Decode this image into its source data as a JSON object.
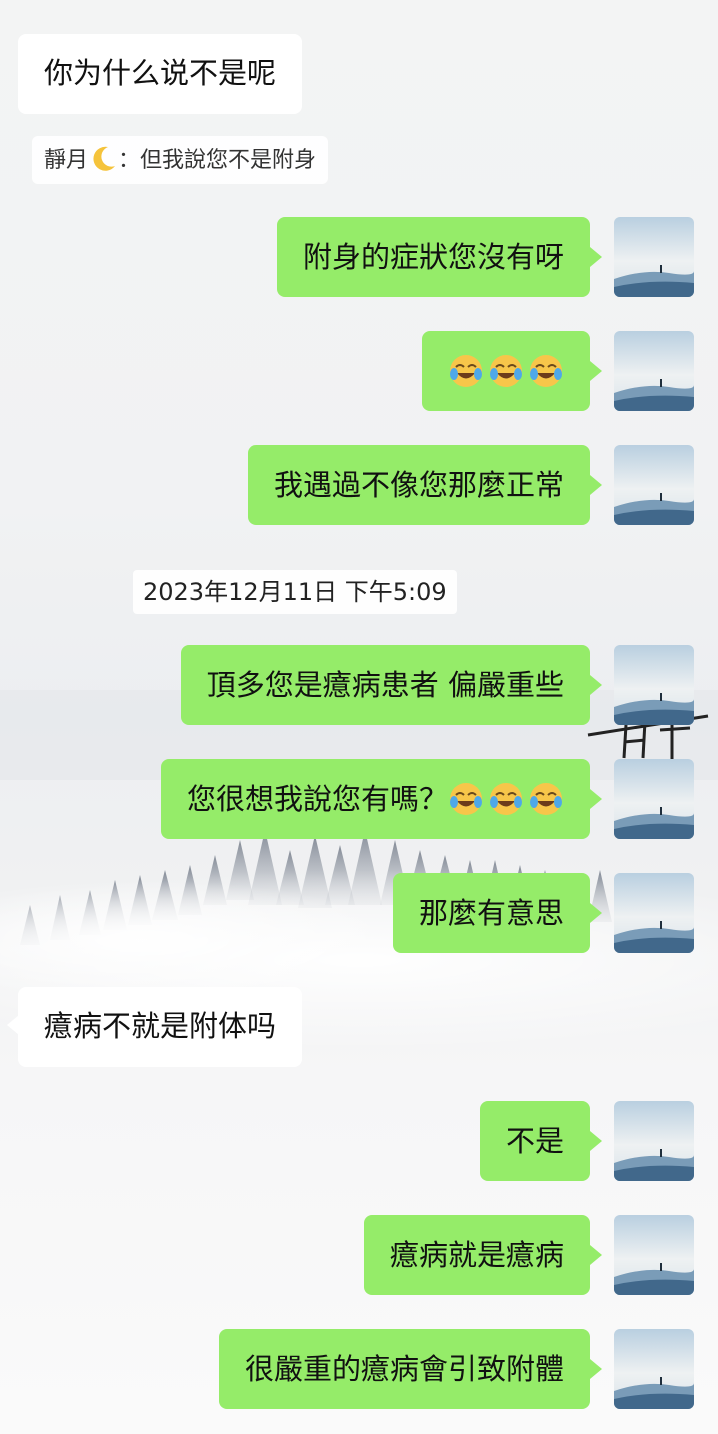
{
  "messages": [
    {
      "id": "m1",
      "side": "in",
      "text": "你为什么说不是呢"
    },
    {
      "id": "q1",
      "side": "quote",
      "sender": "靜月",
      "sep": "：",
      "text": "但我說您不是附身"
    },
    {
      "id": "m2",
      "side": "out",
      "text": "附身的症狀您沒有呀"
    },
    {
      "id": "m3",
      "side": "out",
      "text": "",
      "emoji": [
        "face-with-tears-of-joy",
        "face-with-tears-of-joy",
        "face-with-tears-of-joy"
      ]
    },
    {
      "id": "m4",
      "side": "out",
      "text": "我遇過不像您那麼正常"
    },
    {
      "id": "t1",
      "side": "time",
      "text": "2023年12月11日 下午5:09"
    },
    {
      "id": "m5",
      "side": "out",
      "text": "頂多您是癔病患者 偏嚴重些"
    },
    {
      "id": "m6",
      "side": "out",
      "text": "您很想我說您有嗎？",
      "emoji": [
        "face-with-tears-of-joy",
        "face-with-tears-of-joy",
        "face-with-tears-of-joy"
      ]
    },
    {
      "id": "m7",
      "side": "out",
      "text": "那麼有意思"
    },
    {
      "id": "m8",
      "side": "in",
      "text": "癔病不就是附体吗"
    },
    {
      "id": "m9",
      "side": "out",
      "text": "不是"
    },
    {
      "id": "m10",
      "side": "out",
      "text": "癔病就是癔病"
    },
    {
      "id": "m11",
      "side": "out",
      "text": "很嚴重的癔病會引致附體"
    }
  ],
  "colors": {
    "outgoing": "#95ec69",
    "incoming": "#ffffff",
    "text": "#111111"
  },
  "icons": {
    "sender_emoji": "crescent-moon-icon",
    "avatar": "misty-mountain-avatar"
  }
}
